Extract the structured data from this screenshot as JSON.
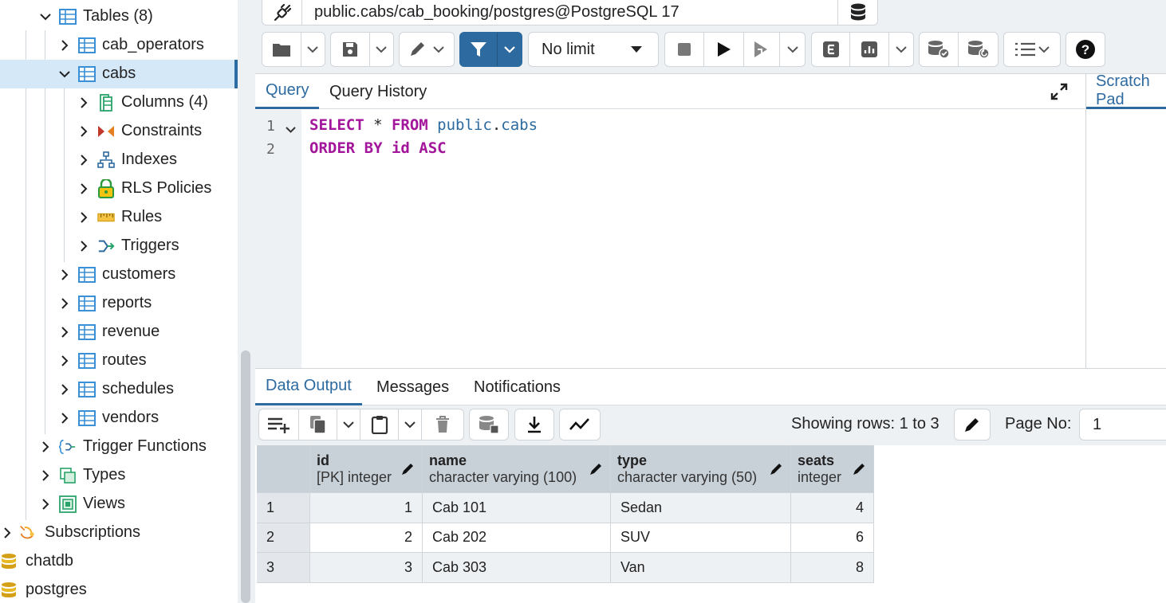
{
  "tree": {
    "items": [
      {
        "label": "Tables",
        "count": "(8)",
        "icon": "table-icon"
      },
      {
        "label": "cab_operators",
        "icon": "table-icon"
      },
      {
        "label": "cabs",
        "icon": "table-icon"
      },
      {
        "label": "Columns",
        "count": "(4)",
        "icon": "columns-icon"
      },
      {
        "label": "Constraints",
        "icon": "constraints-icon"
      },
      {
        "label": "Indexes",
        "icon": "indexes-icon"
      },
      {
        "label": "RLS Policies",
        "icon": "lock-icon"
      },
      {
        "label": "Rules",
        "icon": "rules-icon"
      },
      {
        "label": "Triggers",
        "icon": "triggers-icon"
      },
      {
        "label": "customers",
        "icon": "table-icon"
      },
      {
        "label": "reports",
        "icon": "table-icon"
      },
      {
        "label": "revenue",
        "icon": "table-icon"
      },
      {
        "label": "routes",
        "icon": "table-icon"
      },
      {
        "label": "schedules",
        "icon": "table-icon"
      },
      {
        "label": "vendors",
        "icon": "table-icon"
      },
      {
        "label": "Trigger Functions",
        "icon": "trigger-function-icon"
      },
      {
        "label": "Types",
        "icon": "types-icon"
      },
      {
        "label": "Views",
        "icon": "views-icon"
      },
      {
        "label": "Subscriptions",
        "icon": "subscriptions-icon"
      },
      {
        "label": "chatdb",
        "icon": "database-icon"
      },
      {
        "label": "postgres",
        "icon": "database-icon"
      }
    ]
  },
  "connection": {
    "label": "public.cabs/cab_booking/postgres@PostgreSQL 17"
  },
  "toolbar": {
    "limit": "No limit"
  },
  "query": {
    "tabs": [
      "Query",
      "Query History"
    ],
    "scratch": "Scratch Pad",
    "lines": [
      {
        "num": "1",
        "tokens": [
          {
            "t": "SELECT",
            "c": "kw"
          },
          {
            "t": " * ",
            "c": "op"
          },
          {
            "t": "FROM",
            "c": "kw"
          },
          {
            "t": " public",
            "c": "id"
          },
          {
            "t": ".",
            "c": "op"
          },
          {
            "t": "cabs",
            "c": "id"
          }
        ]
      },
      {
        "num": "2",
        "tokens": [
          {
            "t": "ORDER BY id ASC",
            "c": "kw"
          }
        ]
      }
    ]
  },
  "results": {
    "tabs": [
      "Data Output",
      "Messages",
      "Notifications"
    ],
    "showing": "Showing rows: 1 to 3",
    "page_label": "Page No:",
    "page_value": "1",
    "columns": [
      {
        "name": "id",
        "type": "[PK] integer"
      },
      {
        "name": "name",
        "type": "character varying (100)"
      },
      {
        "name": "type",
        "type": "character varying (50)"
      },
      {
        "name": "seats",
        "type": "integer"
      }
    ],
    "rows": [
      {
        "n": "1",
        "cells": [
          "1",
          "Cab 101",
          "Sedan",
          "4"
        ]
      },
      {
        "n": "2",
        "cells": [
          "2",
          "Cab 202",
          "SUV",
          "6"
        ]
      },
      {
        "n": "3",
        "cells": [
          "3",
          "Cab 303",
          "Van",
          "8"
        ]
      }
    ]
  },
  "colors": {
    "accent": "#2c6aa0",
    "keyword": "#a3169c",
    "selected_row": "#d5e8f8",
    "header_bg": "#c8d0d8"
  }
}
